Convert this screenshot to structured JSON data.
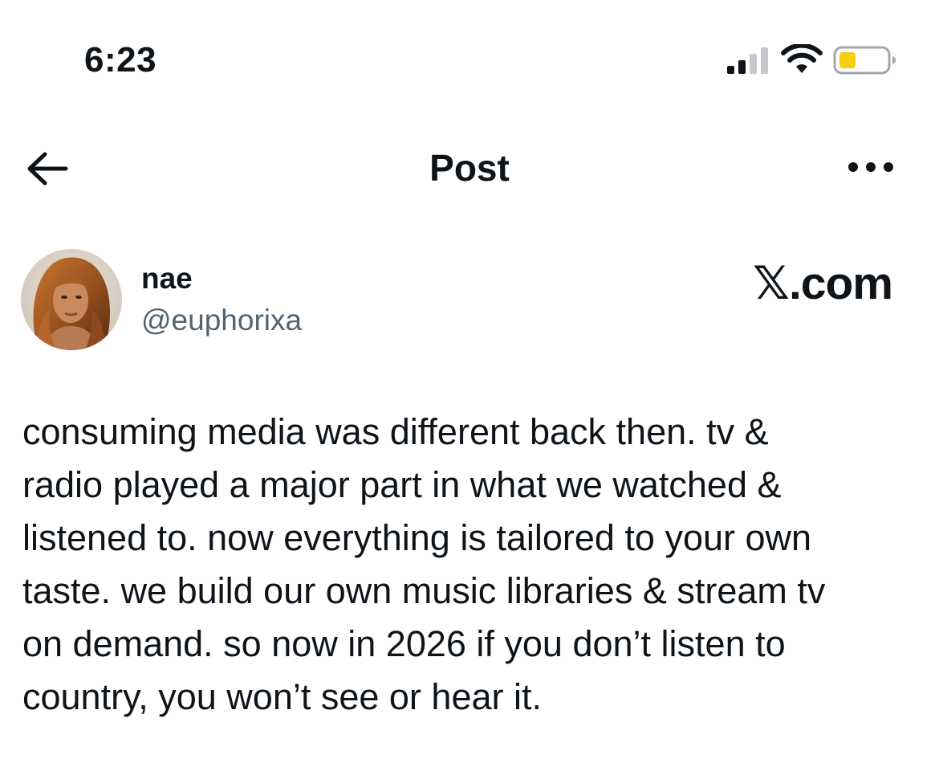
{
  "status_bar": {
    "time": "6:23",
    "battery_color": "#f5cf0a",
    "icons": [
      "cellular-signal-icon",
      "wifi-icon",
      "battery-icon"
    ]
  },
  "nav": {
    "title": "Post",
    "back_icon": "arrow-left-icon",
    "more_icon": "more-horizontal-icon"
  },
  "author": {
    "name": "nae",
    "handle": "@euphorixa",
    "avatar": "profile-photo"
  },
  "site_label": "𝕏.com",
  "post": {
    "lines": [
      "consuming media was different back then. tv &",
      "radio played a major part in what we watched &",
      "listened to. now everything is tailored to your own",
      "taste. we build our own music libraries & stream tv",
      "on demand. so now in 2026 if you don’t listen to",
      "country, you won’t see or hear it."
    ]
  },
  "colors": {
    "text_primary": "#0f1419",
    "text_secondary": "#536471",
    "background": "#ffffff"
  }
}
